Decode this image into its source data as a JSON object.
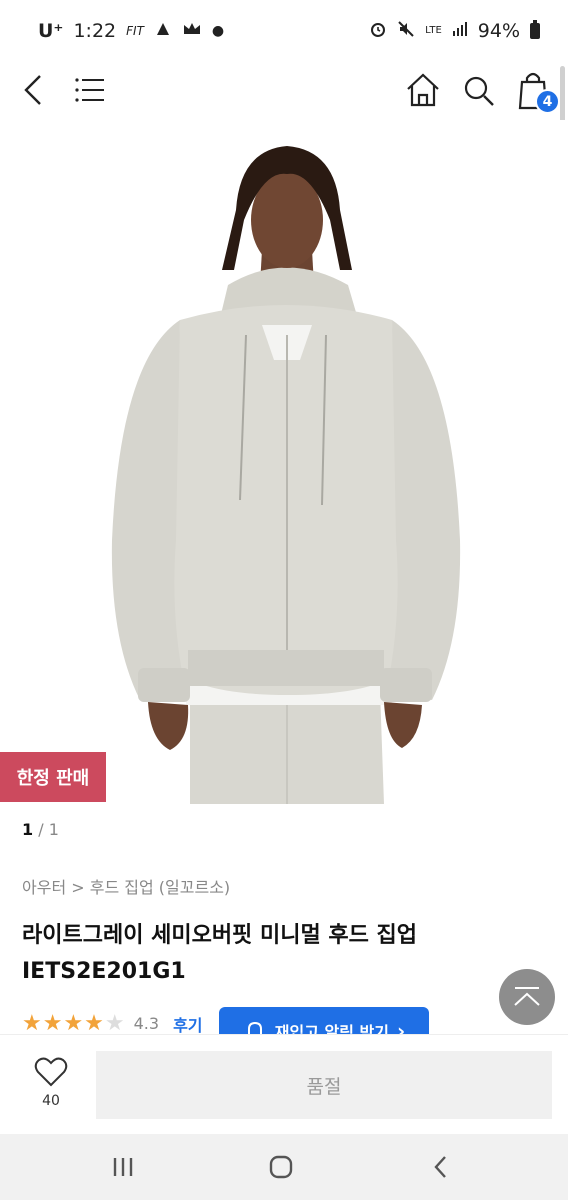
{
  "status_bar": {
    "carrier": "U⁺",
    "time": "1:22",
    "small_label": "FIT",
    "network": "LTE",
    "battery": "94%"
  },
  "nav": {
    "cart_count": "4",
    "icons": [
      "back-icon",
      "menu-icon",
      "home-icon",
      "search-icon",
      "cart-icon"
    ]
  },
  "product": {
    "badge": "한정 판매",
    "pager_current": "1",
    "pager_total": " / 1",
    "breadcrumb": "아우터 > 후드 집업 (일꼬르소)",
    "title_line1": "라이트그레이 세미오버핏 미니멀 후드 집업",
    "title_line2": "IETS2E201G1",
    "rating": "4.3",
    "review_label": "후기",
    "rating_stars": 4.3
  },
  "restock": {
    "label": "재입고 알림 받기",
    "arrow": "›"
  },
  "bottom": {
    "wish_count": "40",
    "soldout_label": "품절"
  },
  "colors": {
    "accent": "#1f6fe5",
    "badge": "#cc4a5e",
    "star": "#f2a33a"
  }
}
